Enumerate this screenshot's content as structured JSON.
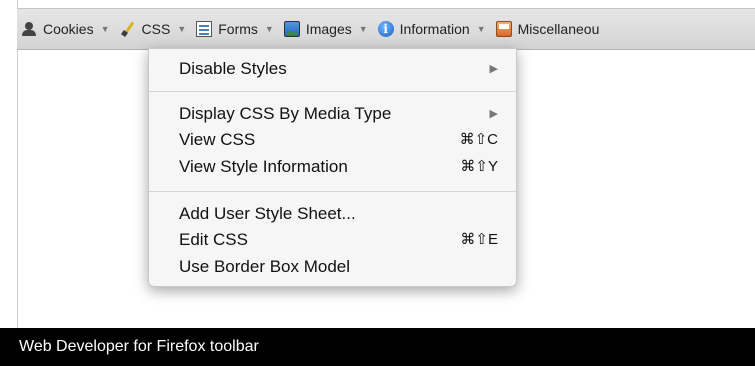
{
  "toolbar": {
    "items": [
      {
        "label": "Cookies",
        "icon": "cookies-icon"
      },
      {
        "label": "CSS",
        "icon": "css-icon"
      },
      {
        "label": "Forms",
        "icon": "forms-icon"
      },
      {
        "label": "Images",
        "icon": "images-icon"
      },
      {
        "label": "Information",
        "icon": "information-icon"
      },
      {
        "label": "Miscellaneou",
        "icon": "miscellaneous-icon"
      }
    ],
    "caret": "▼"
  },
  "menu": {
    "items": [
      {
        "label": "Disable Styles",
        "shortcut": "",
        "submenu": true
      },
      {
        "label": "Display CSS By Media Type",
        "shortcut": "",
        "submenu": true
      },
      {
        "label": "View CSS",
        "shortcut": "⌘⇧C",
        "submenu": false
      },
      {
        "label": "View Style Information",
        "shortcut": "⌘⇧Y",
        "submenu": false
      },
      {
        "label": "Add User Style Sheet...",
        "shortcut": "",
        "submenu": false
      },
      {
        "label": "Edit CSS",
        "shortcut": "⌘⇧E",
        "submenu": false
      },
      {
        "label": "Use Border Box Model",
        "shortcut": "",
        "submenu": false
      }
    ],
    "submenu_arrow": "▶"
  },
  "caption": {
    "text": "Web Developer for Firefox toolbar"
  },
  "colors": {
    "toolbar_bg": "#dcdcdc",
    "menu_bg": "#f6f6f6",
    "caption_bg": "#000000",
    "caption_text": "#ffffff"
  }
}
